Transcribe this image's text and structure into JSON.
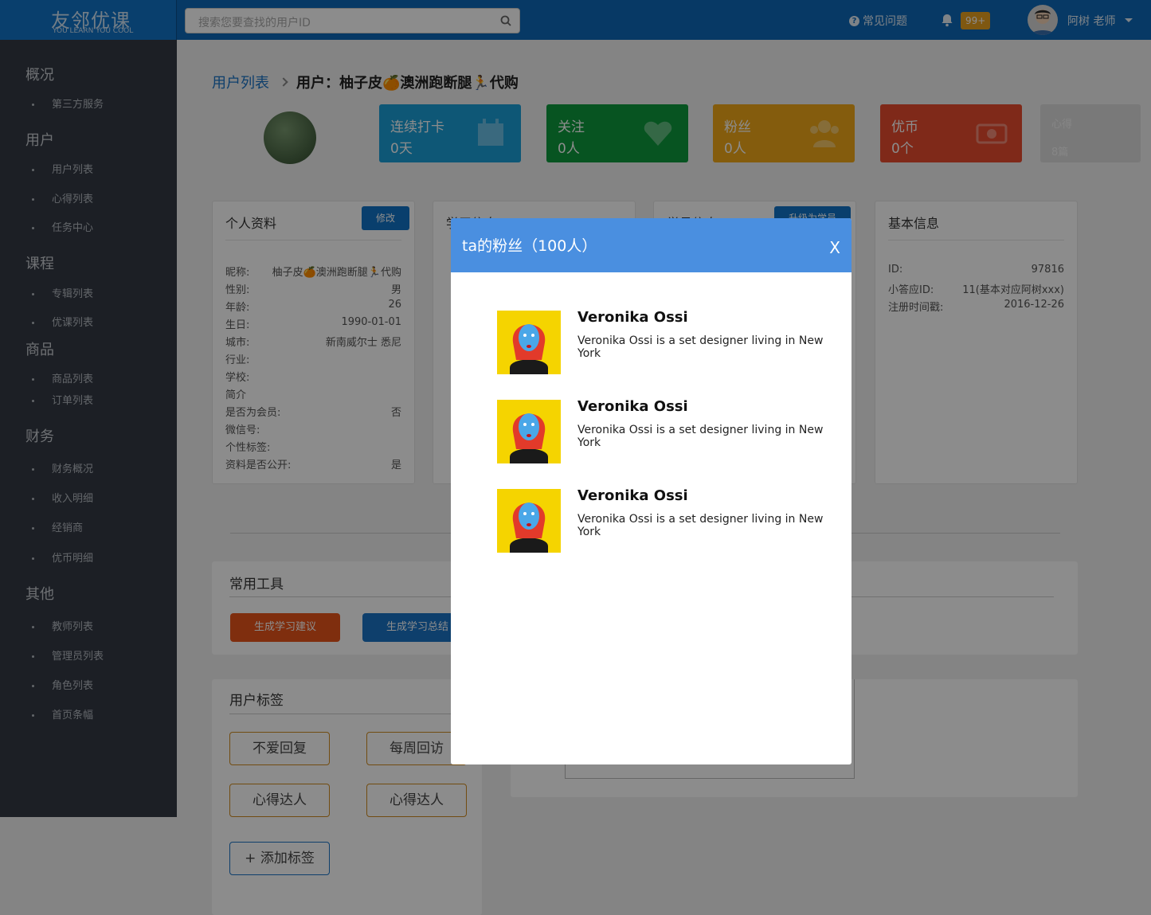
{
  "app": {
    "logo_title": "友邻优课",
    "logo_sub": "YOU LEARN YOU COOL",
    "search_placeholder": "搜索您要查找的用户ID",
    "faq": "常见问题",
    "notif_count": "99+",
    "user": "阿树 老师"
  },
  "sidebar": {
    "groups": [
      {
        "label": "概况",
        "items": [
          "第三方服务"
        ]
      },
      {
        "label": "用户",
        "items": [
          "用户列表",
          "心得列表",
          "任务中心"
        ]
      },
      {
        "label": "课程",
        "items": [
          "专辑列表",
          "优课列表"
        ]
      },
      {
        "label": "商品",
        "items": [
          "商品列表",
          "订单列表"
        ]
      },
      {
        "label": "财务",
        "items": [
          "财务概况",
          "收入明细",
          "经销商",
          "优币明细"
        ]
      },
      {
        "label": "其他",
        "items": [
          "教师列表",
          "管理员列表",
          "角色列表",
          "首页条幅"
        ]
      }
    ]
  },
  "breadcrumb": {
    "link": "用户列表",
    "current": "用户：柚子皮🍊澳洲跑断腿🏃代购"
  },
  "stats": [
    {
      "label": "连续打卡",
      "value": "0天",
      "color": "#1a9fd8"
    },
    {
      "label": "关注",
      "value": "0人",
      "color": "#0e9a3c"
    },
    {
      "label": "粉丝",
      "value": "0人",
      "color": "#f0a818"
    },
    {
      "label": "优币",
      "value": "0个",
      "color": "#e84c2e"
    },
    {
      "label": "心得",
      "value": "8篇",
      "color": "#dcdcdc"
    }
  ],
  "profile": {
    "title": "个人资料",
    "edit": "修改",
    "rows": [
      [
        "昵称:",
        "柚子皮🍊澳洲跑断腿🏃代购"
      ],
      [
        "性别:",
        "男"
      ],
      [
        "年龄:",
        "26"
      ],
      [
        "生日:",
        "1990-01-01"
      ],
      [
        "城市:",
        "新南威尔士 悉尼"
      ],
      [
        "行业:",
        ""
      ],
      [
        "学校:",
        ""
      ],
      [
        "简介",
        ""
      ],
      [
        "是否为会员:",
        "否"
      ],
      [
        "微信号:",
        ""
      ],
      [
        "个性标签:",
        ""
      ],
      [
        "资料是否公开:",
        "是"
      ]
    ]
  },
  "study": {
    "title": "学习信息"
  },
  "member": {
    "title": "学员信息",
    "upgrade": "升级为学员"
  },
  "basic": {
    "title": "基本信息",
    "rows": [
      [
        "ID:",
        "97816"
      ],
      [
        "小答应ID:",
        "11(基本对应阿树xxx)"
      ],
      [
        "注册时间戳:",
        "2016-12-26"
      ]
    ]
  },
  "tools": {
    "title": "常用工具",
    "btn1": "生成学习建议",
    "btn2": "生成学习总结"
  },
  "tags": {
    "title": "用户标签",
    "items": [
      "不爱回复",
      "每周回访",
      "心得达人",
      "心得达人"
    ],
    "add": "+ 添加标签"
  },
  "modal": {
    "title": "ta的粉丝（100人）",
    "close": "X",
    "fans": [
      {
        "name": "Veronika Ossi",
        "desc": "Veronika Ossi is a set designer living in New York"
      },
      {
        "name": "Veronika Ossi",
        "desc": "Veronika Ossi is a set designer living in New York"
      },
      {
        "name": "Veronika Ossi",
        "desc": "Veronika Ossi is a set designer living in New York"
      }
    ]
  }
}
